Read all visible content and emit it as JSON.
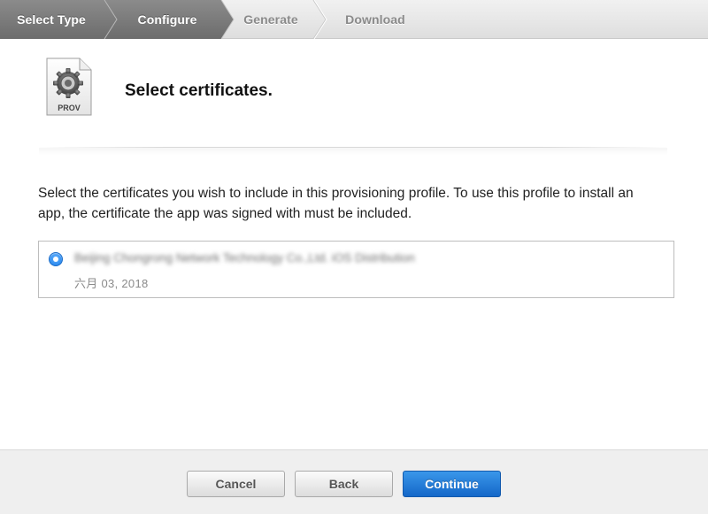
{
  "steps": [
    {
      "label": "Select Type",
      "state": "done"
    },
    {
      "label": "Configure",
      "state": "current"
    },
    {
      "label": "Generate",
      "state": "todo"
    },
    {
      "label": "Download",
      "state": "todo"
    }
  ],
  "header": {
    "icon_label": "PROV",
    "icon_name": "provisioning-profile-icon",
    "title": "Select certificates."
  },
  "description": "Select the certificates you wish to include in this provisioning profile. To use this profile to install an app, the certificate the app was signed with must be included.",
  "certificates": [
    {
      "name": "Beijing Chongrong Network Technology Co.,Ltd. iOS Distribution",
      "date": "六月 03, 2018",
      "selected": true
    }
  ],
  "footer": {
    "cancel_label": "Cancel",
    "back_label": "Back",
    "continue_label": "Continue"
  },
  "colors": {
    "accent": "#1f7fe8",
    "primary_button": "#1a6fd0",
    "step_done": "#7a7a7a",
    "step_todo_text": "#8a8a8a"
  }
}
